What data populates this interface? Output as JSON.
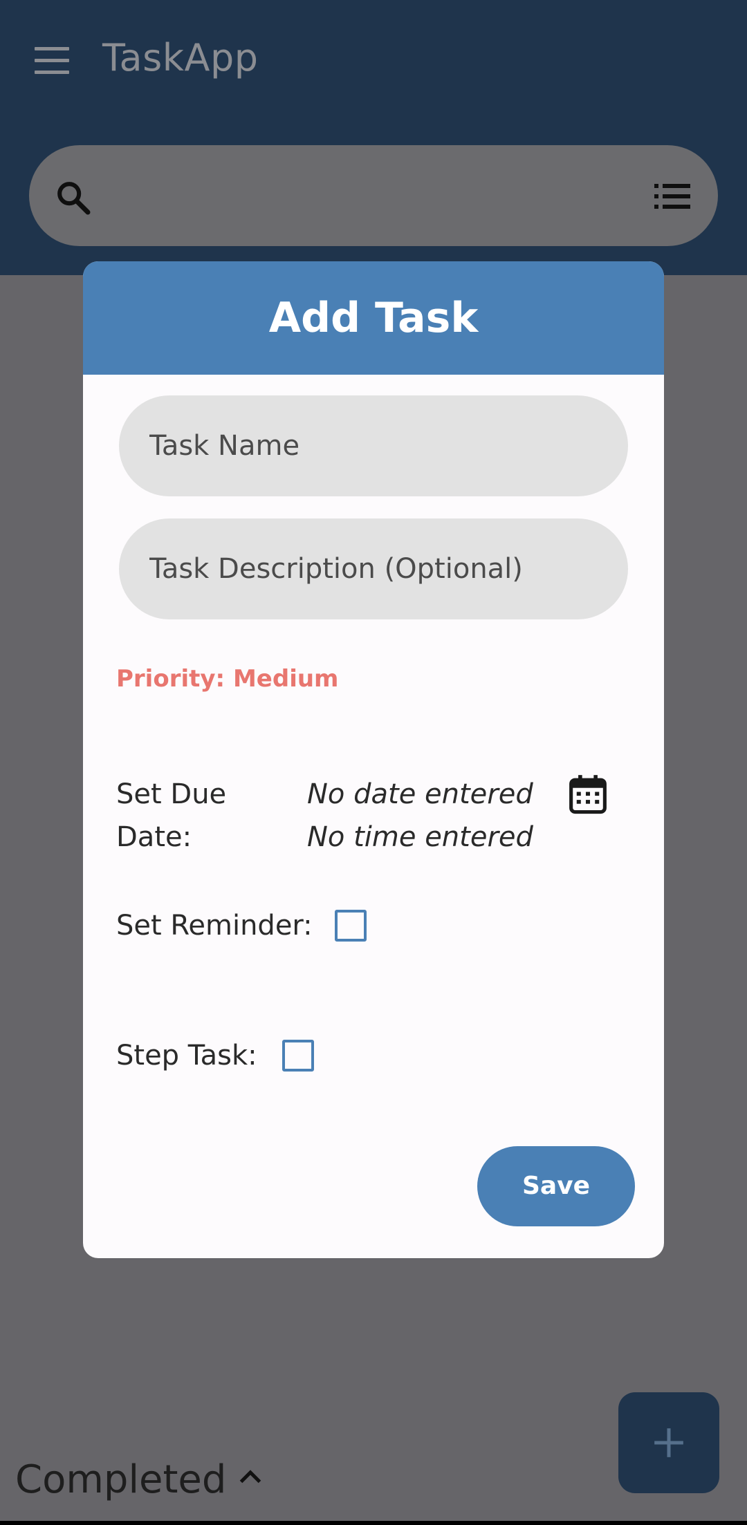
{
  "appbar": {
    "title": "TaskApp",
    "menu_icon": "menu-icon",
    "search_icon": "search-icon",
    "view_icon": "list-view-icon"
  },
  "dialog": {
    "title": "Add Task",
    "task_name_placeholder": "Task Name",
    "task_description_placeholder": "Task Description (Optional)",
    "priority": "Priority: Medium",
    "due_date_label_line1": "Set Due",
    "due_date_label_line2": "Date:",
    "date_value": "No date entered",
    "time_value": "No time entered",
    "reminder_label": "Set Reminder:",
    "reminder_checked": false,
    "step_task_label": "Step Task:",
    "step_task_checked": false,
    "save_label": "Save"
  },
  "bottom": {
    "completed_label": "Completed",
    "fab_icon": "plus-icon"
  },
  "colors": {
    "appbar": "#1f344c",
    "accent": "#4a80b5",
    "priority": "#e8766f",
    "scrim": "#666569"
  }
}
